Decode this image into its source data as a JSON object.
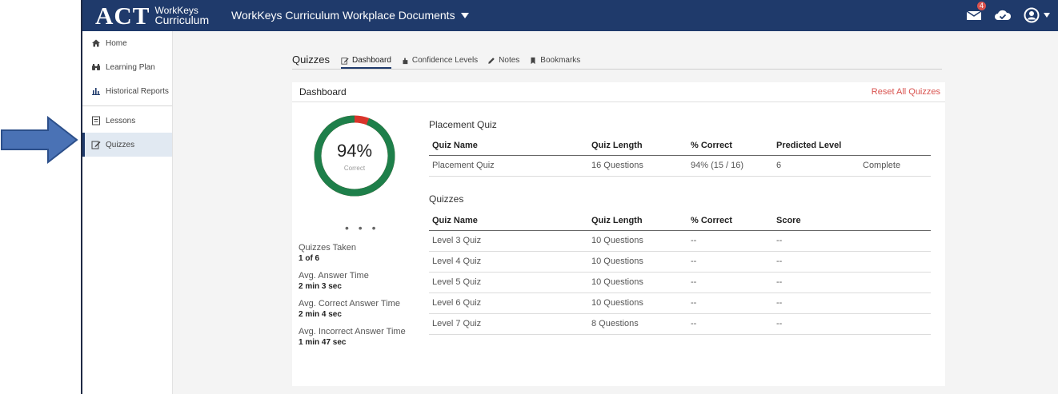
{
  "app": {
    "logo_main": "ACT",
    "logo_sub1": "WorkKeys",
    "logo_sub2": "Curriculum",
    "title": "WorkKeys Curriculum Workplace Documents",
    "mail_badge": "4"
  },
  "sidebar": {
    "items": [
      {
        "label": "Home",
        "icon": "home-icon"
      },
      {
        "label": "Learning Plan",
        "icon": "binoculars-icon"
      },
      {
        "label": "Historical Reports",
        "icon": "bar-chart-icon"
      },
      {
        "label": "Lessons",
        "icon": "document-icon"
      },
      {
        "label": "Quizzes",
        "icon": "edit-icon"
      }
    ]
  },
  "tabs": {
    "title": "Quizzes",
    "items": [
      {
        "label": "Dashboard",
        "icon": "edit-icon"
      },
      {
        "label": "Confidence Levels",
        "icon": "hand-icon"
      },
      {
        "label": "Notes",
        "icon": "pencil-icon"
      },
      {
        "label": "Bookmarks",
        "icon": "bookmark-icon"
      }
    ]
  },
  "dashboard": {
    "title": "Dashboard",
    "reset_label": "Reset All Quizzes",
    "ring": {
      "value": "94%",
      "label": "Correct",
      "fraction": 0.94,
      "color_good": "#1e7f4a",
      "color_bad": "#d9342b"
    },
    "stats": [
      {
        "label": "Quizzes Taken",
        "value": "1 of 6"
      },
      {
        "label": "Avg. Answer Time",
        "value": "2 min 3 sec"
      },
      {
        "label": "Avg. Correct Answer Time",
        "value": "2 min 4 sec"
      },
      {
        "label": "Avg. Incorrect Answer Time",
        "value": "1 min 47 sec"
      }
    ]
  },
  "placement": {
    "title": "Placement Quiz",
    "headers": [
      "Quiz Name",
      "Quiz Length",
      "% Correct",
      "Predicted Level",
      ""
    ],
    "rows": [
      [
        "Placement Quiz",
        "16 Questions",
        "94% (15 / 16)",
        "6",
        "Complete"
      ]
    ]
  },
  "quizzes": {
    "title": "Quizzes",
    "headers": [
      "Quiz Name",
      "Quiz Length",
      "% Correct",
      "Score",
      ""
    ],
    "rows": [
      [
        "Level 3 Quiz",
        "10 Questions",
        "--",
        "--",
        ""
      ],
      [
        "Level 4 Quiz",
        "10 Questions",
        "--",
        "--",
        ""
      ],
      [
        "Level 5 Quiz",
        "10 Questions",
        "--",
        "--",
        ""
      ],
      [
        "Level 6 Quiz",
        "10 Questions",
        "--",
        "--",
        ""
      ],
      [
        "Level 7 Quiz",
        "8 Questions",
        "--",
        "--",
        ""
      ]
    ]
  },
  "colors": {
    "brand": "#1f3a6b",
    "accent_red": "#d9534f",
    "complete_green": "#2e7d32"
  }
}
